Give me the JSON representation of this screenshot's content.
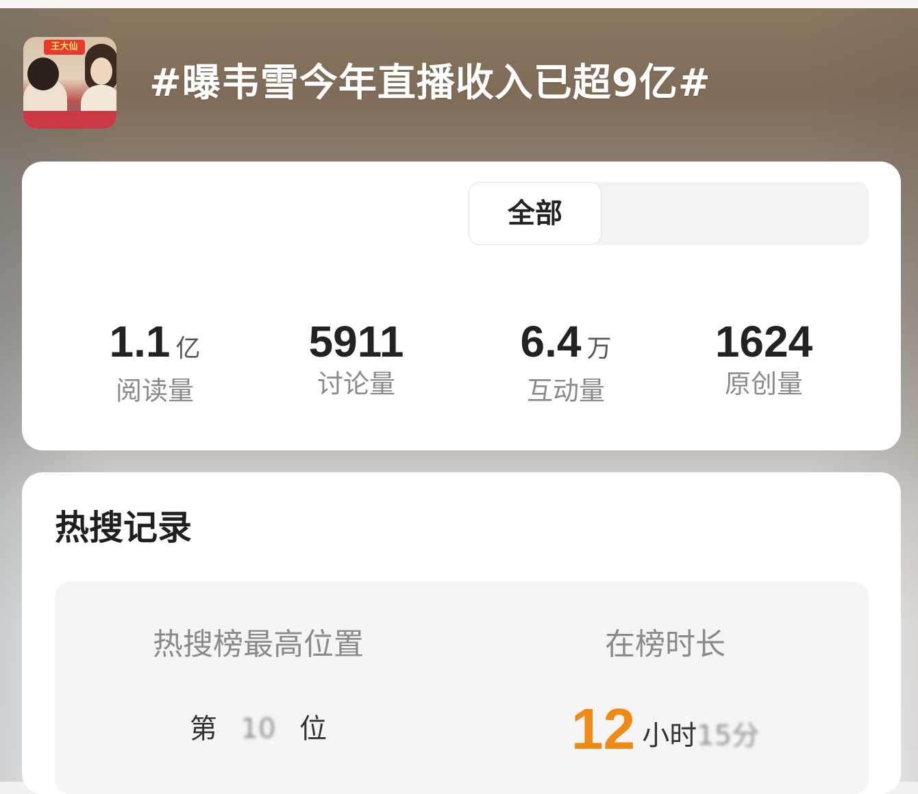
{
  "header": {
    "topic_title": "#曝韦雪今年直播收入已超9亿#",
    "avatar_sign_text": "王大仙"
  },
  "tabs": {
    "active": "全部"
  },
  "stats": [
    {
      "value": "1.1",
      "unit": "亿",
      "label": "阅读量"
    },
    {
      "value": "5911",
      "unit": "",
      "label": "讨论量"
    },
    {
      "value": "6.4",
      "unit": "万",
      "label": "互动量"
    },
    {
      "value": "1624",
      "unit": "",
      "label": "原创量"
    }
  ],
  "hot_search": {
    "heading": "热搜记录",
    "peak_label": "热搜榜最高位置",
    "peak_prefix": "第",
    "peak_value_obscured": "10",
    "peak_suffix": "位",
    "duration_label": "在榜时长",
    "duration_value": "12",
    "duration_unit": "小时",
    "duration_tail_obscured": "15分"
  },
  "colors": {
    "accent_orange": "#f08a16",
    "card_bg": "#ffffff",
    "inner_bg": "#f5f5f5"
  }
}
